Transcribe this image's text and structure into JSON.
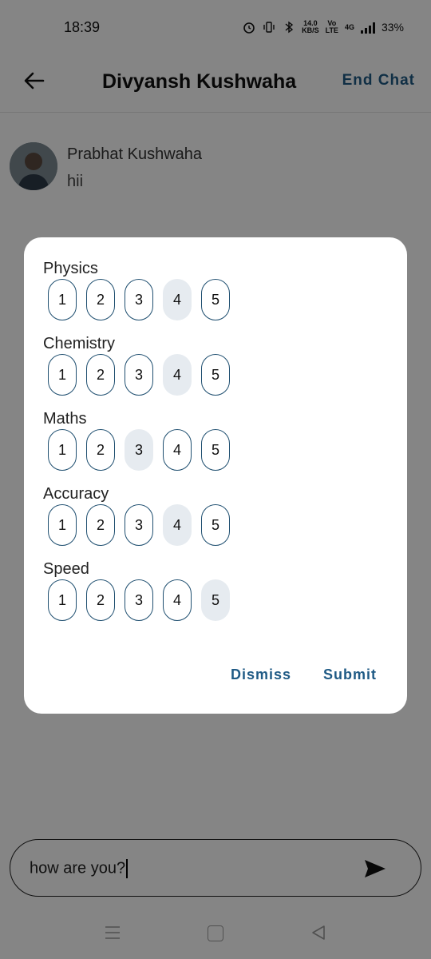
{
  "status_bar": {
    "time": "18:39",
    "icons": [
      "alarm-icon",
      "vibrate-icon",
      "bluetooth-icon",
      "data-speed",
      "volte-icon",
      "4g-signal-icon",
      "signal-icon"
    ],
    "data_speed_value": "14.0",
    "data_speed_unit": "KB/S",
    "volte_top": "Vo",
    "volte_bottom": "LTE",
    "network": "4G",
    "battery": "33%"
  },
  "header": {
    "title": "Divyansh Kushwaha",
    "end_chat_label": "End Chat"
  },
  "message": {
    "sender": "Prabhat Kushwaha",
    "text": "hii"
  },
  "rating_dialog": {
    "groups": [
      {
        "label": "Physics",
        "options": [
          "1",
          "2",
          "3",
          "4",
          "5"
        ],
        "selected": "4"
      },
      {
        "label": "Chemistry",
        "options": [
          "1",
          "2",
          "3",
          "4",
          "5"
        ],
        "selected": "4"
      },
      {
        "label": "Maths",
        "options": [
          "1",
          "2",
          "3",
          "4",
          "5"
        ],
        "selected": "3"
      },
      {
        "label": "Accuracy",
        "options": [
          "1",
          "2",
          "3",
          "4",
          "5"
        ],
        "selected": "4"
      },
      {
        "label": "Speed",
        "options": [
          "1",
          "2",
          "3",
          "4",
          "5"
        ],
        "selected": "5"
      }
    ],
    "dismiss_label": "Dismiss",
    "submit_label": "Submit"
  },
  "composer": {
    "value": "how are you?"
  },
  "colors": {
    "accent": "#1f5a85",
    "selected_bg": "#e6ebf0",
    "scrim": "rgba(0,0,0,0.48)"
  }
}
